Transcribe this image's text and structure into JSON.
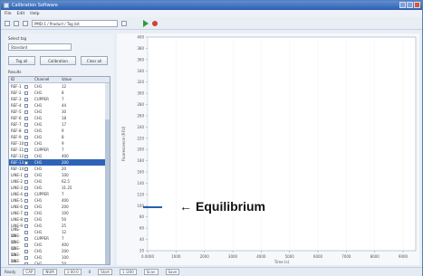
{
  "window": {
    "title": "Calibration Software"
  },
  "menu": [
    "File",
    "Edit",
    "Help"
  ],
  "toolbar": {
    "combo": "PMD-1 / Product / Tag list"
  },
  "left": {
    "select_label": "Select tag",
    "select_value": "Standard",
    "buttons": [
      "Tag all",
      "Calibration",
      "Clear all"
    ],
    "table_label": "Results",
    "columns": [
      "ID",
      "",
      "Channel",
      "Value"
    ],
    "rows": [
      [
        "REF-1",
        "CH1",
        "12"
      ],
      [
        "REF-2",
        "CH1",
        "8"
      ],
      [
        "REF-3",
        "CUPPER",
        "7"
      ],
      [
        "REF-4",
        "CH1",
        "44"
      ],
      [
        "REF-5",
        "CH1",
        "30"
      ],
      [
        "REF-6",
        "CH1",
        "18"
      ],
      [
        "REF-7",
        "CH1",
        "17"
      ],
      [
        "REF-8",
        "CH1",
        "9"
      ],
      [
        "REF-9",
        "CH1",
        "8"
      ],
      [
        "REF-10",
        "CH1",
        "9"
      ],
      [
        "REF-11",
        "CUPPER",
        "7"
      ],
      [
        "REF-12",
        "CH1",
        "400"
      ],
      [
        "REF-13",
        "CH1",
        "200"
      ],
      [
        "REF-14",
        "CH1",
        "20"
      ],
      [
        "LINE-1",
        "CH1",
        "100"
      ],
      [
        "LINE-2",
        "CH1",
        "62.5"
      ],
      [
        "LINE-3",
        "CH1",
        "31.25"
      ],
      [
        "LINE-4",
        "CUPPER",
        "7"
      ],
      [
        "LINE-5",
        "CH1",
        "400"
      ],
      [
        "LINE-6",
        "CH1",
        "200"
      ],
      [
        "LINE-7",
        "CH1",
        "100"
      ],
      [
        "LINE-8",
        "CH1",
        "50"
      ],
      [
        "LINE-9",
        "CH1",
        "25"
      ],
      [
        "LINE-10",
        "CH1",
        "12"
      ],
      [
        "LINE-11",
        "CUPPER",
        "7"
      ],
      [
        "LINE-12",
        "CH1",
        "400"
      ],
      [
        "LINE-13",
        "CH1",
        "200"
      ],
      [
        "LINE-14",
        "CH1",
        "100"
      ],
      [
        "LINE-15",
        "CH1",
        "50"
      ],
      [
        "LINE-16",
        "CH1",
        "25"
      ]
    ],
    "selected_row": 12
  },
  "chart": {
    "ylabel": "Fluorescence (RFU)",
    "xlabel": "Time (s)",
    "yticks": [
      "400",
      "380",
      "360",
      "340",
      "320",
      "300",
      "280",
      "260",
      "240",
      "220",
      "200",
      "180",
      "160",
      "140",
      "120",
      "100",
      "80",
      "60",
      "40",
      "20"
    ],
    "xticks": [
      "0.0000",
      "1000",
      "2000",
      "3000",
      "4000",
      "5000",
      "6000",
      "7000",
      "8000",
      "9000"
    ]
  },
  "status": [
    "Ready",
    "CAP",
    "NUM",
    "1:00:0",
    "0",
    "Start",
    "1 /200",
    "Scan",
    "Save"
  ],
  "callout": {
    "arrow": "←",
    "text": "Equilibrium",
    "color": "#2a5db0"
  },
  "colors": {
    "accent": "#2e63b8",
    "title": "#2d5fb0"
  }
}
